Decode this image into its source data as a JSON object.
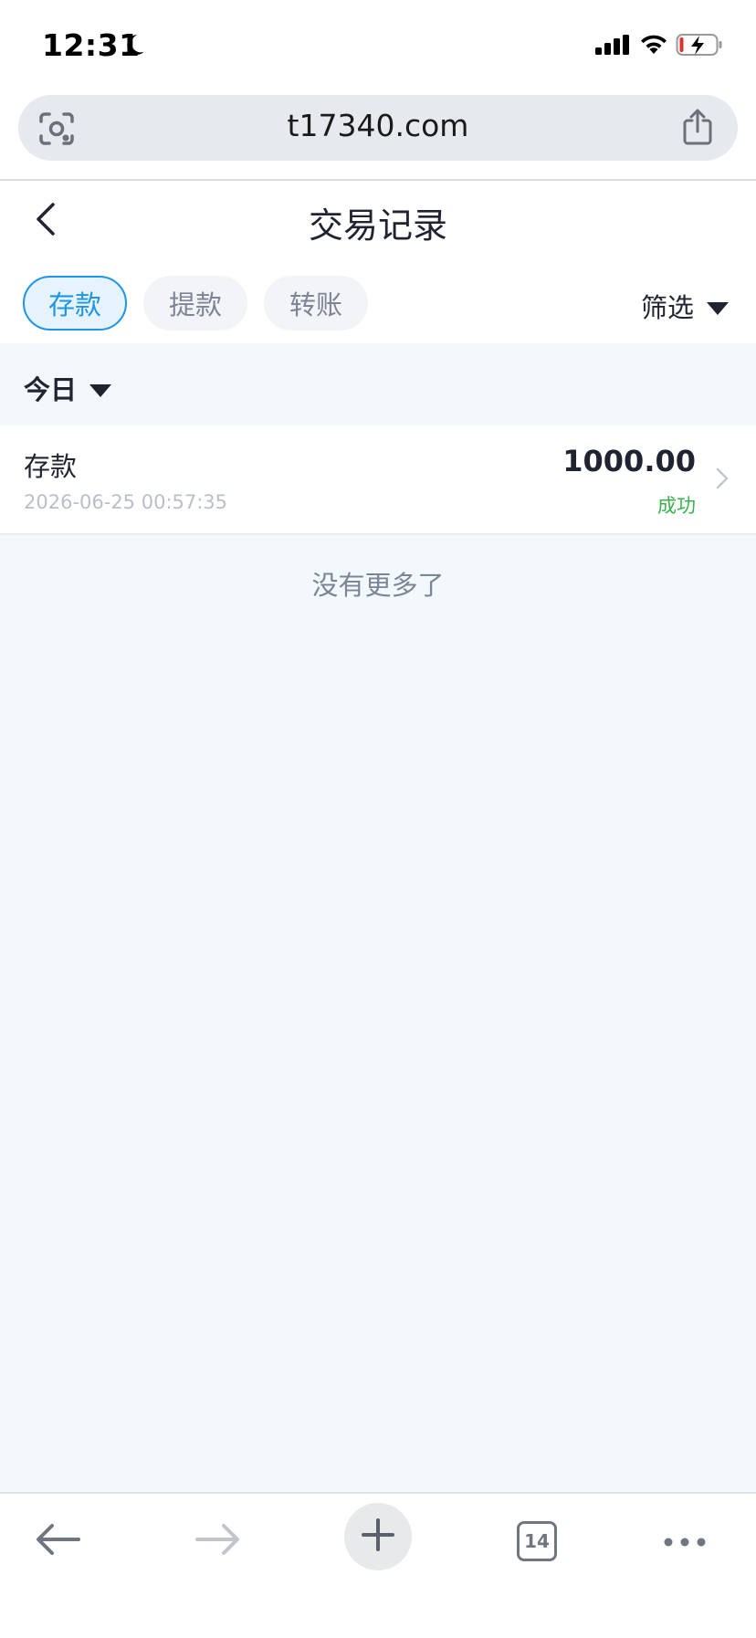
{
  "status_bar": {
    "time": "12:31"
  },
  "browser": {
    "url": "t17340.com",
    "tab_count": "14"
  },
  "header": {
    "title": "交易记录"
  },
  "tabs": [
    {
      "label": "存款",
      "active": true
    },
    {
      "label": "提款",
      "active": false
    },
    {
      "label": "转账",
      "active": false
    }
  ],
  "filter": {
    "label": "筛选"
  },
  "date_filter": {
    "label": "今日"
  },
  "records": [
    {
      "type": "存款",
      "time": "2026-06-25 00:57:35",
      "amount": "1000.00",
      "status": "成功"
    }
  ],
  "list_footer": "没有更多了",
  "colors": {
    "accent": "#1e95e6",
    "success": "#37b24d",
    "page_bg": "#f3f8fd"
  }
}
